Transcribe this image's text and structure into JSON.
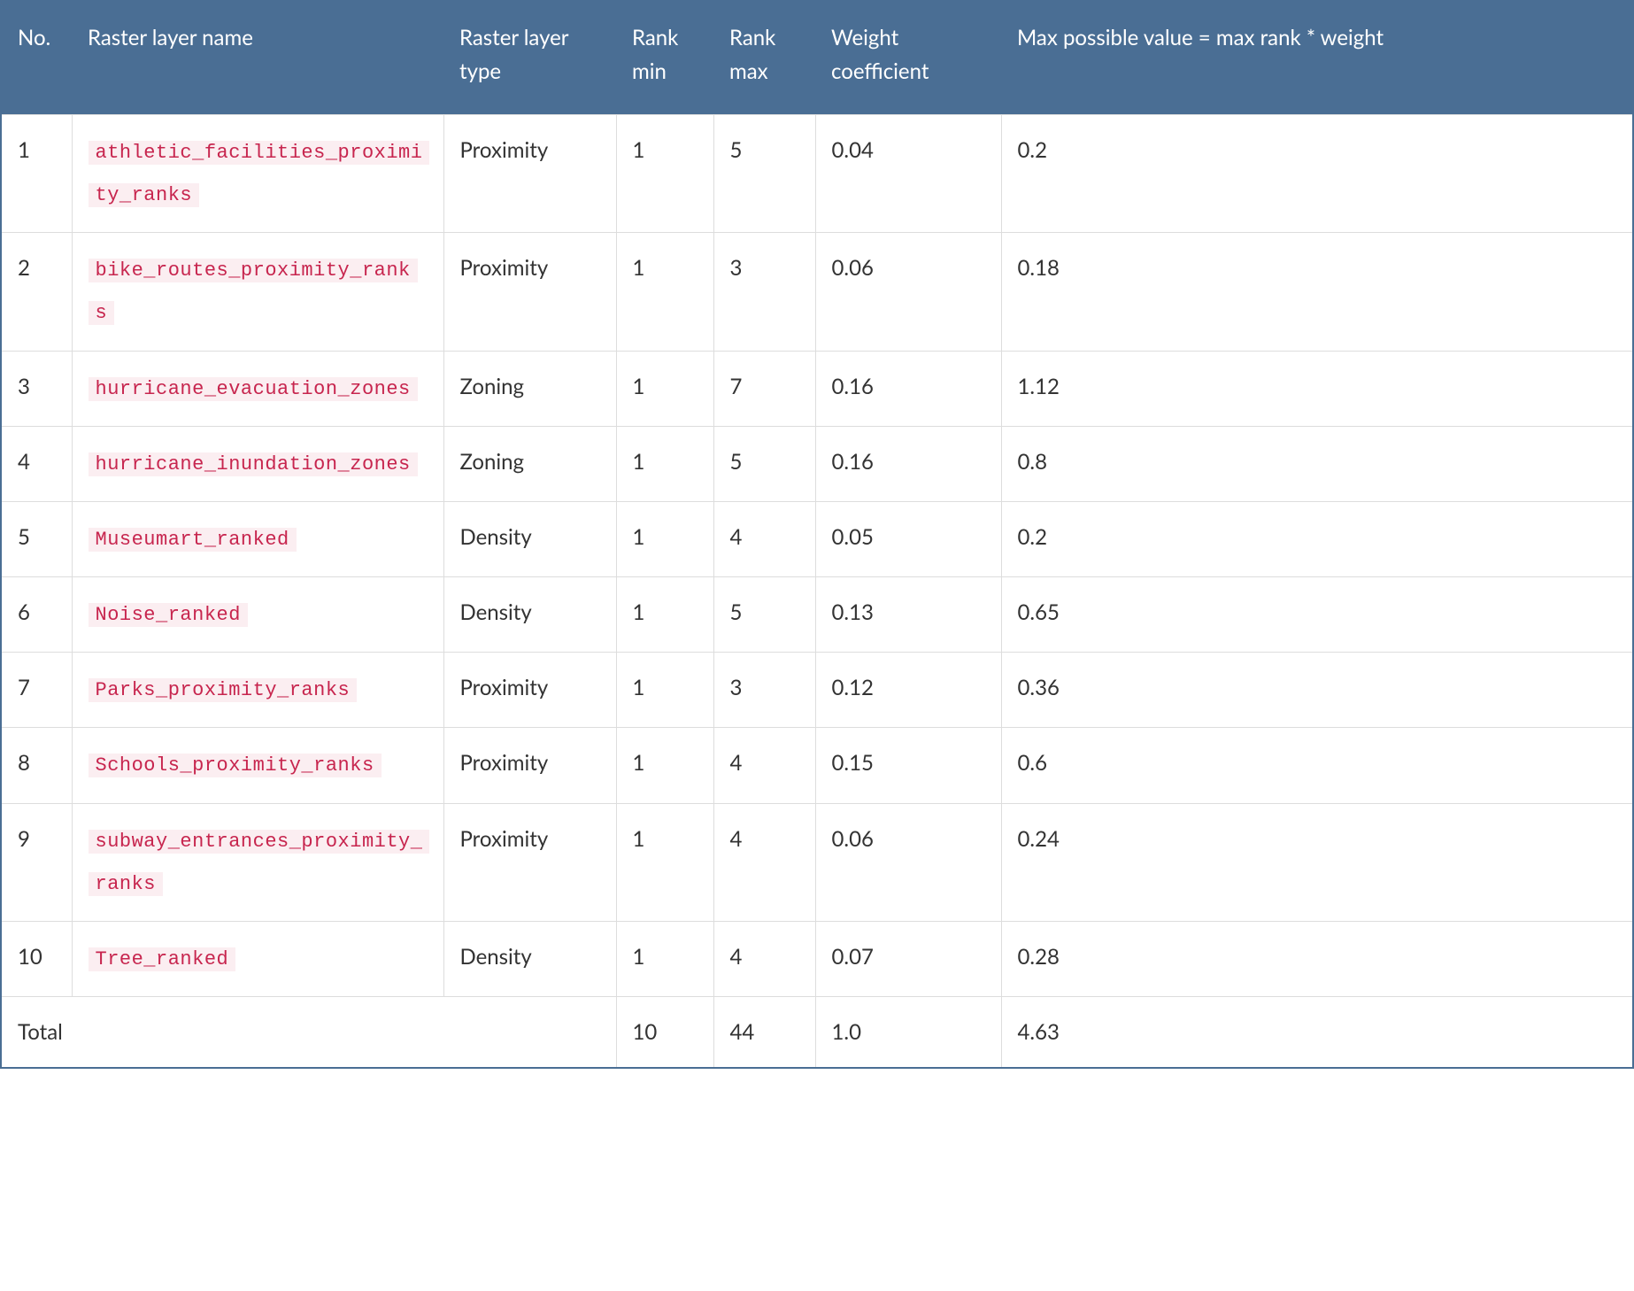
{
  "chart_data": {
    "type": "table",
    "title": "",
    "columns": [
      "No.",
      "Raster layer name",
      "Raster layer type",
      "Rank min",
      "Rank max",
      "Weight coefficient",
      "Max possible value = max rank * weight"
    ],
    "rows": [
      {
        "no": "1",
        "name": "athletic_facilities_proximity_ranks",
        "type": "Proximity",
        "min": "1",
        "max": "5",
        "weight": "0.04",
        "maxval": "0.2"
      },
      {
        "no": "2",
        "name": "bike_routes_proximity_ranks",
        "type": "Proximity",
        "min": "1",
        "max": "3",
        "weight": "0.06",
        "maxval": "0.18"
      },
      {
        "no": "3",
        "name": "hurricane_evacuation_zones",
        "type": "Zoning",
        "min": "1",
        "max": "7",
        "weight": "0.16",
        "maxval": "1.12"
      },
      {
        "no": "4",
        "name": "hurricane_inundation_zones",
        "type": "Zoning",
        "min": "1",
        "max": "5",
        "weight": "0.16",
        "maxval": "0.8"
      },
      {
        "no": "5",
        "name": "Museumart_ranked",
        "type": "Density",
        "min": "1",
        "max": "4",
        "weight": "0.05",
        "maxval": "0.2"
      },
      {
        "no": "6",
        "name": "Noise_ranked",
        "type": "Density",
        "min": "1",
        "max": "5",
        "weight": "0.13",
        "maxval": "0.65"
      },
      {
        "no": "7",
        "name": "Parks_proximity_ranks",
        "type": "Proximity",
        "min": "1",
        "max": "3",
        "weight": "0.12",
        "maxval": "0.36"
      },
      {
        "no": "8",
        "name": "Schools_proximity_ranks",
        "type": "Proximity",
        "min": "1",
        "max": "4",
        "weight": "0.15",
        "maxval": "0.6"
      },
      {
        "no": "9",
        "name": "subway_entrances_proximity_ranks",
        "type": "Proximity",
        "min": "1",
        "max": "4",
        "weight": "0.06",
        "maxval": "0.24"
      },
      {
        "no": "10",
        "name": "Tree_ranked",
        "type": "Density",
        "min": "1",
        "max": "4",
        "weight": "0.07",
        "maxval": "0.28"
      }
    ],
    "total": {
      "label": "Total",
      "min": "10",
      "max": "44",
      "weight": "1.0",
      "maxval": "4.63"
    }
  }
}
